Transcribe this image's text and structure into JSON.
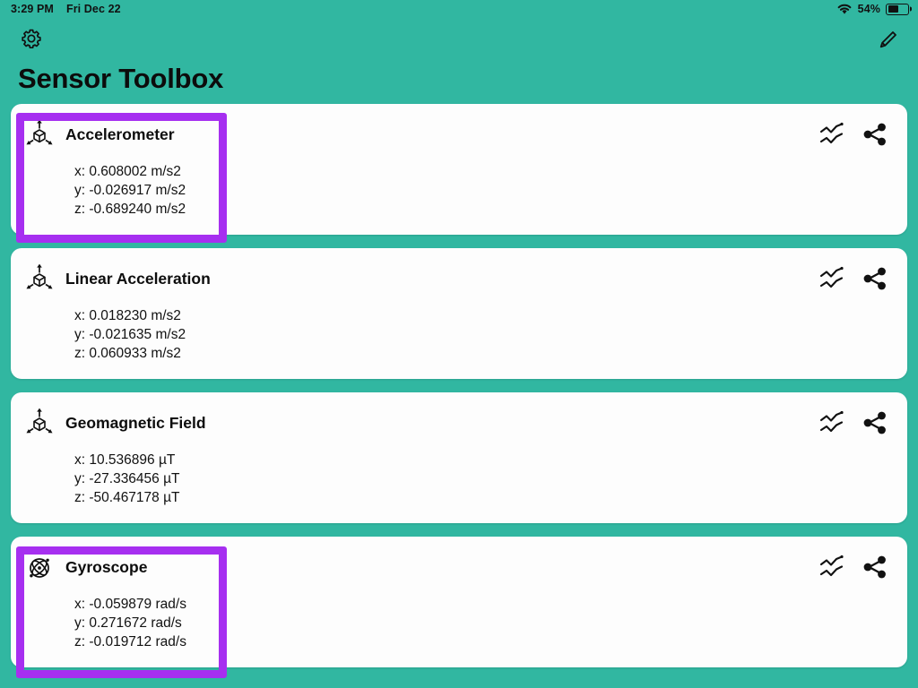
{
  "statusbar": {
    "time": "3:29 PM",
    "date": "Fri Dec 22",
    "wifi_icon": "wifi-icon",
    "battery_percent": "54%",
    "battery_icon": "battery-icon",
    "battery_level": 54
  },
  "appbar": {
    "settings_icon": "gear-icon",
    "edit_icon": "pencil-icon"
  },
  "header": {
    "title": "Sensor Toolbox"
  },
  "actions": {
    "chart_icon": "line-chart-icon",
    "share_icon": "share-icon"
  },
  "cards": [
    {
      "id": "accelerometer",
      "title": "Accelerometer",
      "icon": "three-axis-cube-icon",
      "x": "x: 0.608002 m/s2",
      "y": "y: -0.026917 m/s2",
      "z": "z: -0.689240 m/s2",
      "highlighted": true
    },
    {
      "id": "linear-acceleration",
      "title": "Linear Acceleration",
      "icon": "three-axis-cube-icon",
      "x": "x: 0.018230 m/s2",
      "y": "y: -0.021635 m/s2",
      "z": "z: 0.060933 m/s2",
      "highlighted": false
    },
    {
      "id": "geomagnetic-field",
      "title": "Geomagnetic Field",
      "icon": "three-axis-cube-icon",
      "x": "x: 10.536896 µT",
      "y": "y: -27.336456 µT",
      "z": "z: -50.467178 µT",
      "highlighted": false
    },
    {
      "id": "gyroscope",
      "title": "Gyroscope",
      "icon": "gyroscope-atom-icon",
      "x": "x: -0.059879 rad/s",
      "y": "y: 0.271672 rad/s",
      "z": "z: -0.019712 rad/s",
      "highlighted": true
    }
  ],
  "colors": {
    "background_teal": "#31b7a1",
    "card_white": "#fdfdfd",
    "highlight_purple": "#a62ff0",
    "text_black": "#111111"
  }
}
